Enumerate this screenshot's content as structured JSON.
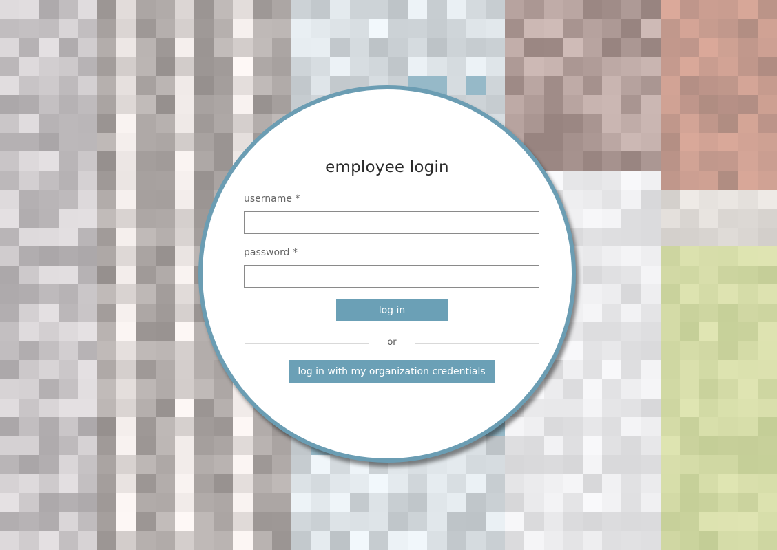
{
  "login": {
    "title": "employee login",
    "username_label": "username",
    "password_label": "password",
    "required_marker": "*",
    "username_value": "",
    "password_value": "",
    "login_button": "log in",
    "divider_text": "or",
    "sso_button": "log in with my organization credentials"
  },
  "colors": {
    "accent": "#6b9db3",
    "button": "#6ba0b6",
    "card": "#ffffff"
  }
}
